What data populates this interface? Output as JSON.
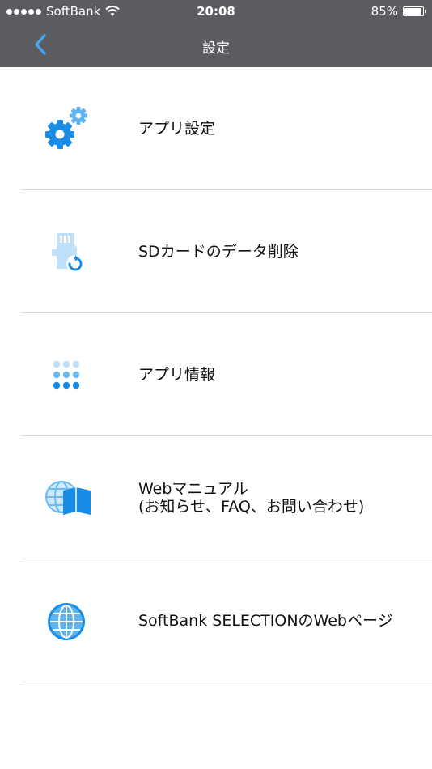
{
  "status_bar": {
    "carrier": "SoftBank",
    "time": "20:08",
    "battery": "85%"
  },
  "nav": {
    "title": "設定"
  },
  "items": [
    {
      "icon": "gears-icon",
      "lines": [
        "アプリ設定"
      ]
    },
    {
      "icon": "sd-card-refresh-icon",
      "lines": [
        "SDカードのデータ削除"
      ]
    },
    {
      "icon": "app-grid-icon",
      "lines": [
        "アプリ情報"
      ]
    },
    {
      "icon": "globe-book-icon",
      "lines": [
        "Webマニュアル",
        "(お知らせ、FAQ、お問い合わせ)"
      ]
    },
    {
      "icon": "globe-icon",
      "lines": [
        "SoftBank SELECTIONのWebページ"
      ]
    }
  ],
  "colors": {
    "bar": "#5a5c60",
    "accent": "#1a8ce6",
    "accent_light": "#9fd0f5"
  }
}
